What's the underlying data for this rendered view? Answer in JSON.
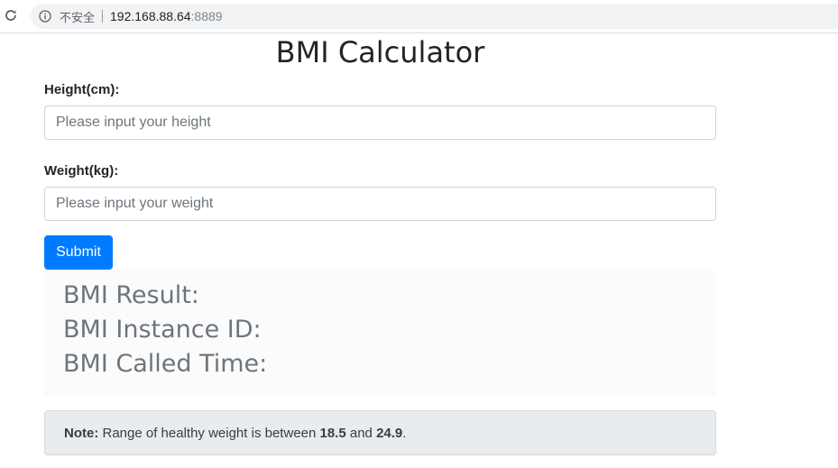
{
  "browser": {
    "security_text": "不安全",
    "url_host": "192.168.88.64",
    "url_port": ":8889",
    "reload_icon": "reload-icon",
    "info_icon": "info-icon"
  },
  "page": {
    "title": "BMI Calculator"
  },
  "form": {
    "height_label": "Height(cm):",
    "height_placeholder": "Please input your height",
    "height_value": "",
    "weight_label": "Weight(kg):",
    "weight_placeholder": "Please input your weight",
    "weight_value": "",
    "submit_label": "Submit"
  },
  "result": {
    "bmi_result_label": "BMI Result:",
    "instance_id_label": "BMI Instance ID:",
    "called_time_label": "BMI Called Time:"
  },
  "note": {
    "prefix": "Note:",
    "text_before": " Range of healthy weight is between ",
    "low_value": "18.5",
    "text_middle": " and ",
    "high_value": "24.9",
    "text_after": "."
  },
  "colors": {
    "primary": "#007bff",
    "muted_text": "#6c757d",
    "note_bg": "#e9ecef"
  }
}
